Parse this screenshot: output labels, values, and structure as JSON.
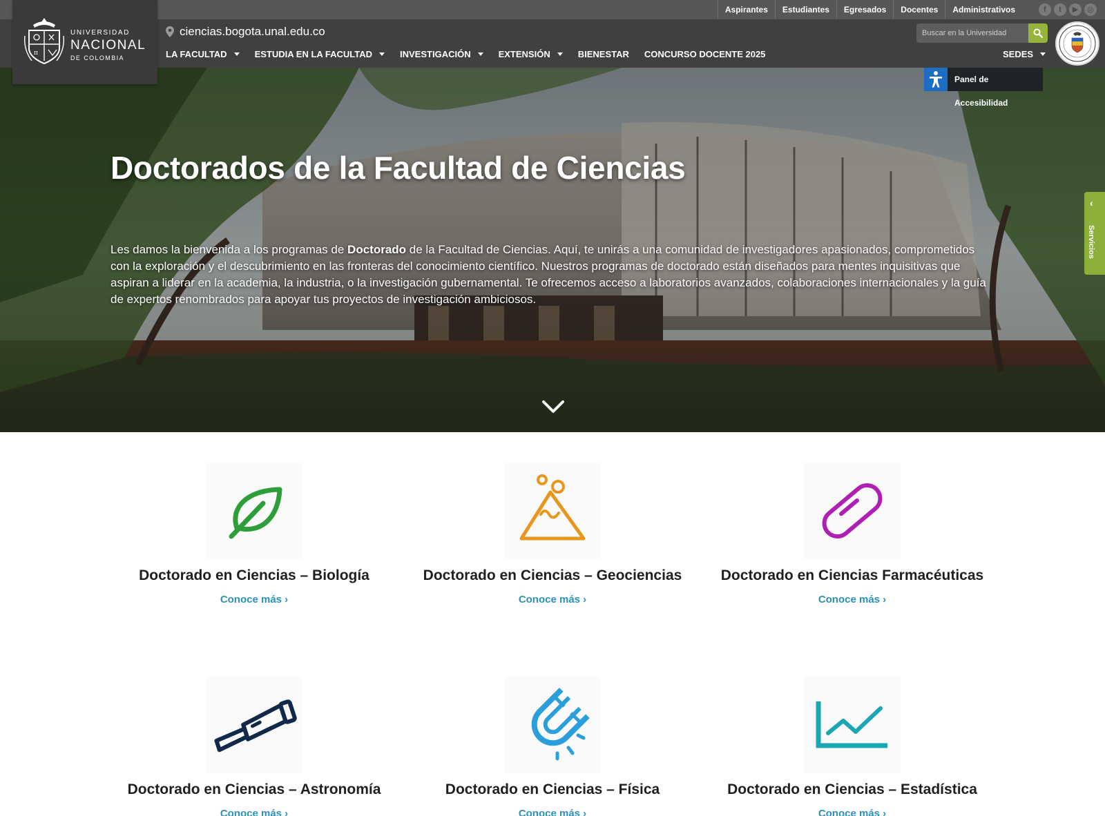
{
  "topbar": {
    "links": [
      "Aspirantes",
      "Estudiantes",
      "Egresados",
      "Docentes",
      "Administrativos"
    ],
    "social_icons": [
      "facebook-icon",
      "twitter-icon",
      "youtube-icon",
      "rss-icon"
    ]
  },
  "logo": {
    "line1": "UNIVERSIDAD",
    "line2": "NACIONAL",
    "line3": "DE COLOMBIA"
  },
  "header": {
    "site_url": "ciencias.bogota.unal.edu.co",
    "search_placeholder": "Buscar en la Universidad",
    "sedes_label": "SEDES"
  },
  "nav": {
    "items": [
      {
        "label": "LA FACULTAD",
        "dropdown": true
      },
      {
        "label": "ESTUDIA EN LA FACULTAD",
        "dropdown": true
      },
      {
        "label": "INVESTIGACIÓN",
        "dropdown": true
      },
      {
        "label": "EXTENSIÓN",
        "dropdown": true
      },
      {
        "label": "BIENESTAR",
        "dropdown": false
      },
      {
        "label": "CONCURSO DOCENTE 2025",
        "dropdown": false
      }
    ]
  },
  "accessibility": {
    "label": "Panel de Accesibilidad"
  },
  "services_tab": {
    "label": "Servicios"
  },
  "hero": {
    "title": "Doctorados de la Facultad de Ciencias",
    "text_before": "Les damos la bienvenida a los programas de ",
    "text_bold": "Doctorado",
    "text_after": " de la Facultad de Ciencias. Aquí, te unirás a una comunidad de investigadores apasionados, comprometidos con la exploración y el descubrimiento en las fronteras del conocimiento científico. Nuestros programas de doctorado están diseñados para mentes inquisitivas que aspiran a liderar en la academia, la industria, o la investigación gubernamental. Te ofrecemos acceso a laboratorios avanzados, colaboraciones internacionales y la guía de expertos renombrados para apoyar tus proyectos de investigación ambiciosos."
  },
  "programs": [
    {
      "title": "Doctorado en Ciencias – Biología",
      "link": "Conoce más ›",
      "icon": "leaf-icon",
      "color": "#2e9e3a"
    },
    {
      "title": "Doctorado en Ciencias – Geociencias",
      "link": "Conoce más ›",
      "icon": "volcano-icon",
      "color": "#e8961e"
    },
    {
      "title": "Doctorado en Ciencias Farmacéuticas",
      "link": "Conoce más ›",
      "icon": "pill-icon",
      "color": "#b01fb4"
    },
    {
      "title": "Doctorado en Ciencias – Astronomía",
      "link": "Conoce más ›",
      "icon": "telescope-icon",
      "color": "#10294a"
    },
    {
      "title": "Doctorado en Ciencias – Física",
      "link": "Conoce más ›",
      "icon": "magnet-icon",
      "color": "#2a9fdc"
    },
    {
      "title": "Doctorado en Ciencias – Estadística",
      "link": "Conoce más ›",
      "icon": "line-chart-icon",
      "color": "#1aa6b3"
    }
  ]
}
